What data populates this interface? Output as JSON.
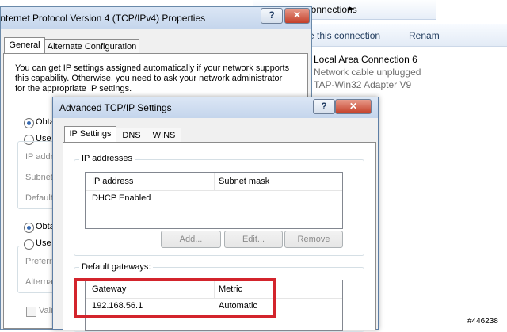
{
  "network_window": {
    "breadcrumb": "Connections",
    "breadcrumb_arrow": "▶",
    "command_rename_connection": "e this connection",
    "command_rename": "Renam",
    "connection": {
      "name": "Local Area Connection 6",
      "status": "Network cable unplugged",
      "adapter": "TAP-Win32 Adapter V9"
    }
  },
  "ipv4_dialog": {
    "title": "Internet Protocol Version 4 (TCP/IPv4) Properties",
    "help_label": "?",
    "close_label": "✕",
    "tabs": [
      {
        "label": "General"
      },
      {
        "label": "Alternate Configuration"
      }
    ],
    "description_lines": [
      "You can get IP settings assigned automatically if your network supports",
      "this capability. Otherwise, you need to ask your network administrator",
      "for the appropriate IP settings."
    ],
    "radio_obtain_ip": "Obta",
    "radio_use_ip": "Use t",
    "ip_address_label": "IP addres",
    "subnet_label": "Subnet",
    "default_label": "Default",
    "radio_obtain_dns": "Obta",
    "radio_use_dns": "Use t",
    "preferred_label": "Preferre",
    "alternate_label": "Alterna",
    "validate_label": "Valid"
  },
  "advanced_dialog": {
    "title": "Advanced TCP/IP Settings",
    "help_label": "?",
    "close_label": "✕",
    "tabs": [
      {
        "label": "IP Settings"
      },
      {
        "label": "DNS"
      },
      {
        "label": "WINS"
      }
    ],
    "ip_addresses": {
      "group_label": "IP addresses",
      "columns": [
        "IP address",
        "Subnet mask"
      ],
      "rows": [
        [
          "DHCP Enabled",
          ""
        ]
      ],
      "buttons": {
        "add": "Add...",
        "edit": "Edit...",
        "remove": "Remove"
      }
    },
    "gateways": {
      "group_label": "Default gateways:",
      "columns": [
        "Gateway",
        "Metric"
      ],
      "rows": [
        [
          "192.168.56.1",
          "Automatic"
        ]
      ]
    },
    "highlight_color": "#d3242c"
  },
  "watermark": "#446238"
}
